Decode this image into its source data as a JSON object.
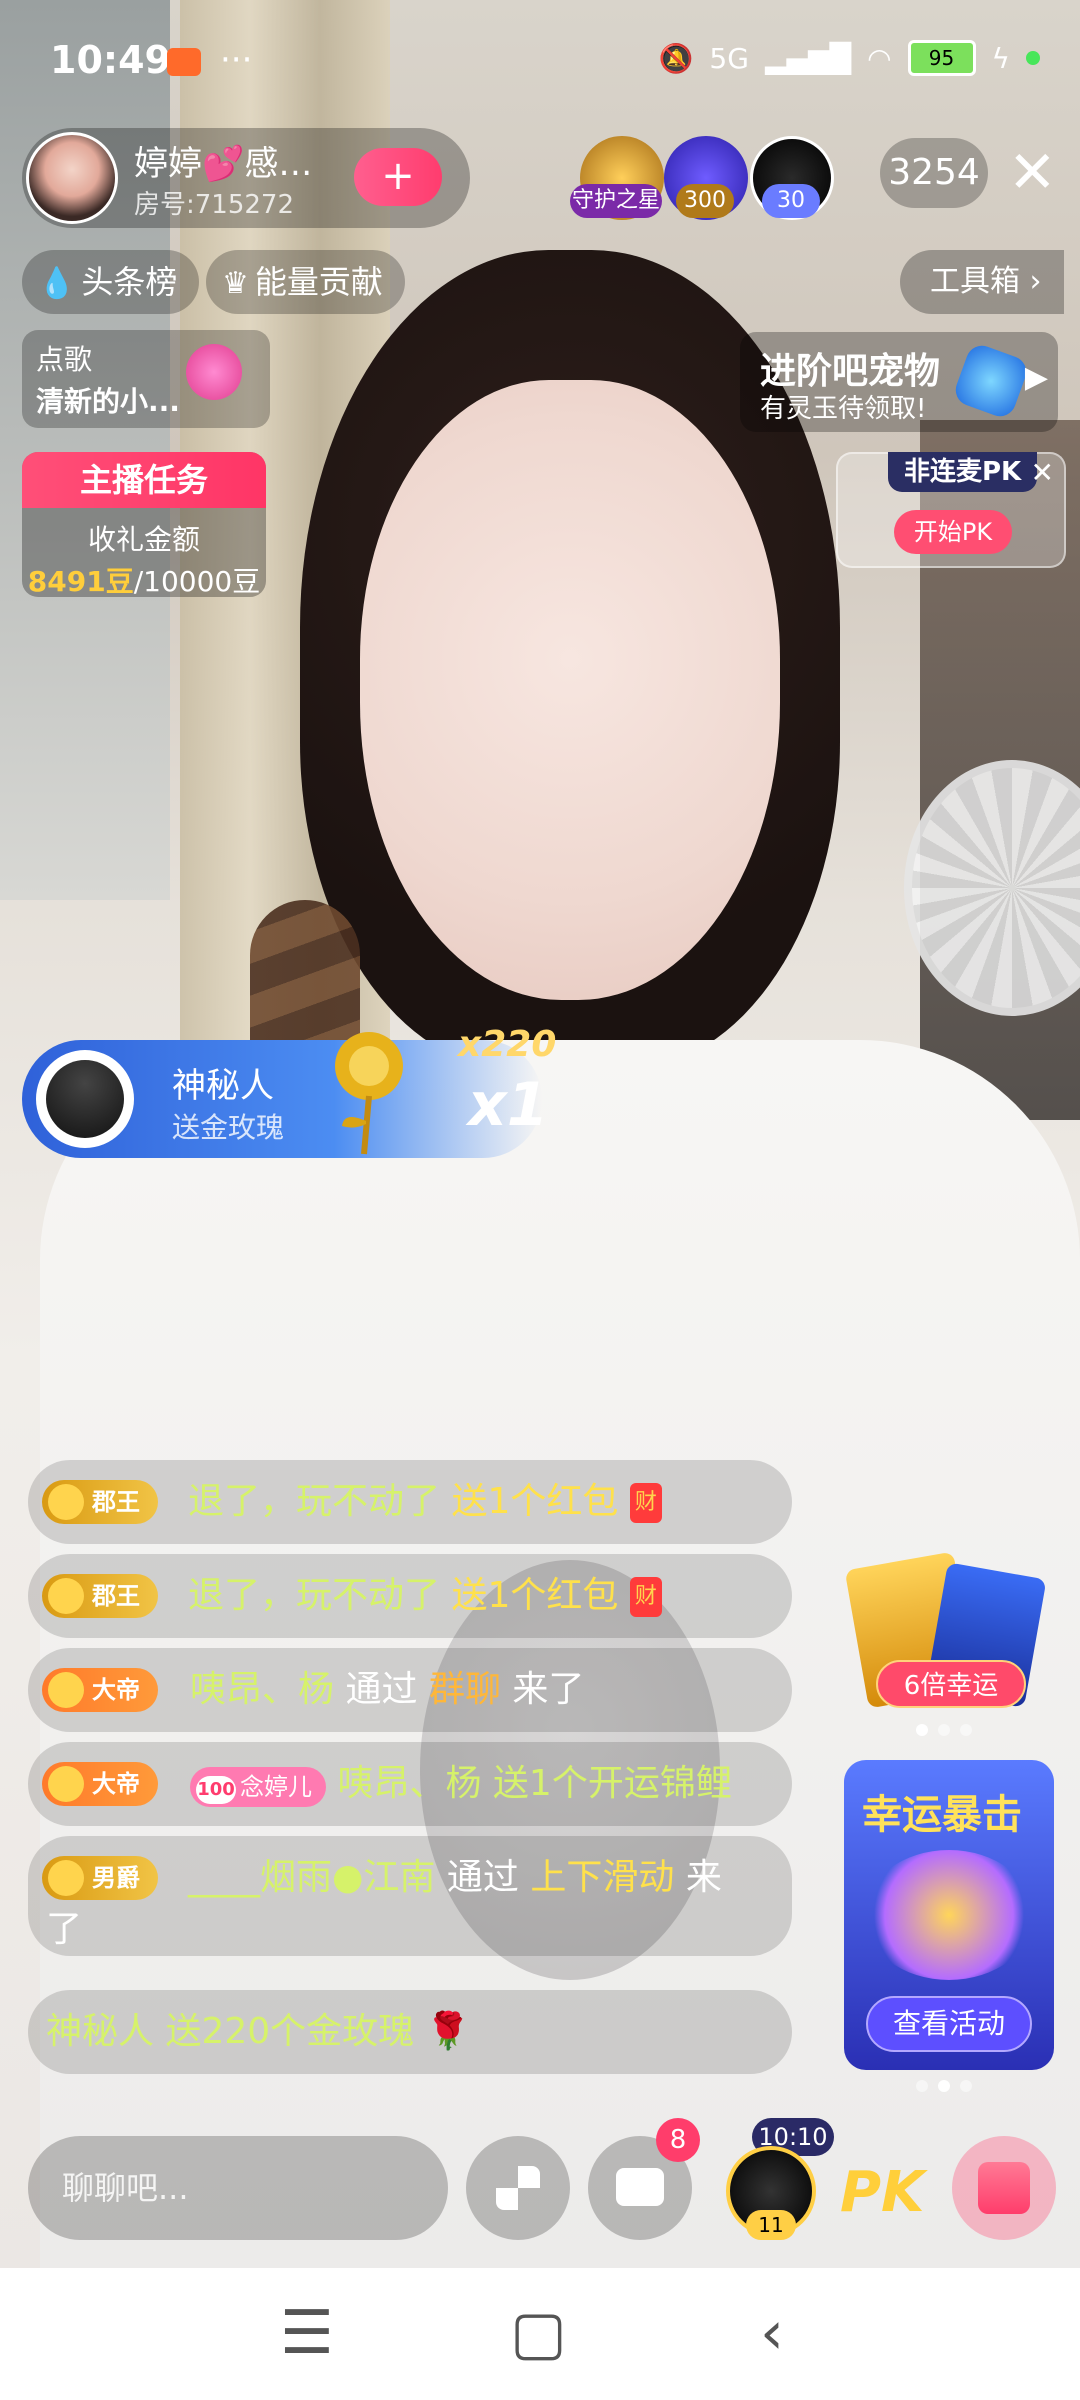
{
  "status_bar": {
    "time": "10:49",
    "dots": "···",
    "network": "5G",
    "battery": "95"
  },
  "host": {
    "name": "婷婷💕感…",
    "room": "房号:715272",
    "follow_label": "+"
  },
  "top_right": {
    "viewer_badges": [
      "守护之星",
      "300",
      "30"
    ],
    "online_count": "3254",
    "close": "✕"
  },
  "chips": {
    "headline": "头条榜",
    "energy": "能量贡献",
    "toolbox": "工具箱 ›"
  },
  "song": {
    "label": "点歌",
    "title": "清新的小..."
  },
  "task": {
    "header": "主播任务",
    "label": "收礼金额",
    "current": "8491豆",
    "target": "/10000豆"
  },
  "pet": {
    "title": "进阶吧宠物",
    "subtitle": "有灵玉待领取!"
  },
  "pk": {
    "tag": "非连麦PK",
    "button": "开始PK"
  },
  "gift_banner": {
    "user": "神秘人",
    "action": "送金玫瑰",
    "combo": "x220",
    "count": "x1"
  },
  "chat": {
    "m1": {
      "badge": "郡王",
      "text": "退了，玩不动了",
      "action": "送1个红包",
      "icon": "财"
    },
    "m2": {
      "badge": "郡王",
      "text": "退了，玩不动了",
      "action": "送1个红包",
      "icon": "财"
    },
    "m3": {
      "badge": "大帝",
      "user": "咦昂、杨",
      "via": "通过",
      "source": "群聊",
      "tail": "来了"
    },
    "m4": {
      "badge": "大帝",
      "lvl": "100",
      "lvl_name": "念婷儿",
      "user": "咦昂、杨",
      "action": "送1个开运锦鲤"
    },
    "m5": {
      "badge": "男爵",
      "user": "____烟雨●江南",
      "via": "通过",
      "source": "上下滑动",
      "tail": "来",
      "tail2": "了"
    },
    "m6": {
      "text": "神秘人 送220个金玫瑰"
    }
  },
  "promos": {
    "lucky_label": "6倍幸运",
    "event_title": "幸运暴击",
    "event_button": "查看活动"
  },
  "bottom": {
    "input_placeholder": "聊聊吧...",
    "message_badge": "8",
    "timer": "10:10",
    "level": "11",
    "pk_label": "PK"
  },
  "colors": {
    "accent_pink": "#ff3c6e",
    "gold": "#ffce3b",
    "chat_green": "#d6f26a",
    "chat_yellow": "#ffe14b"
  }
}
